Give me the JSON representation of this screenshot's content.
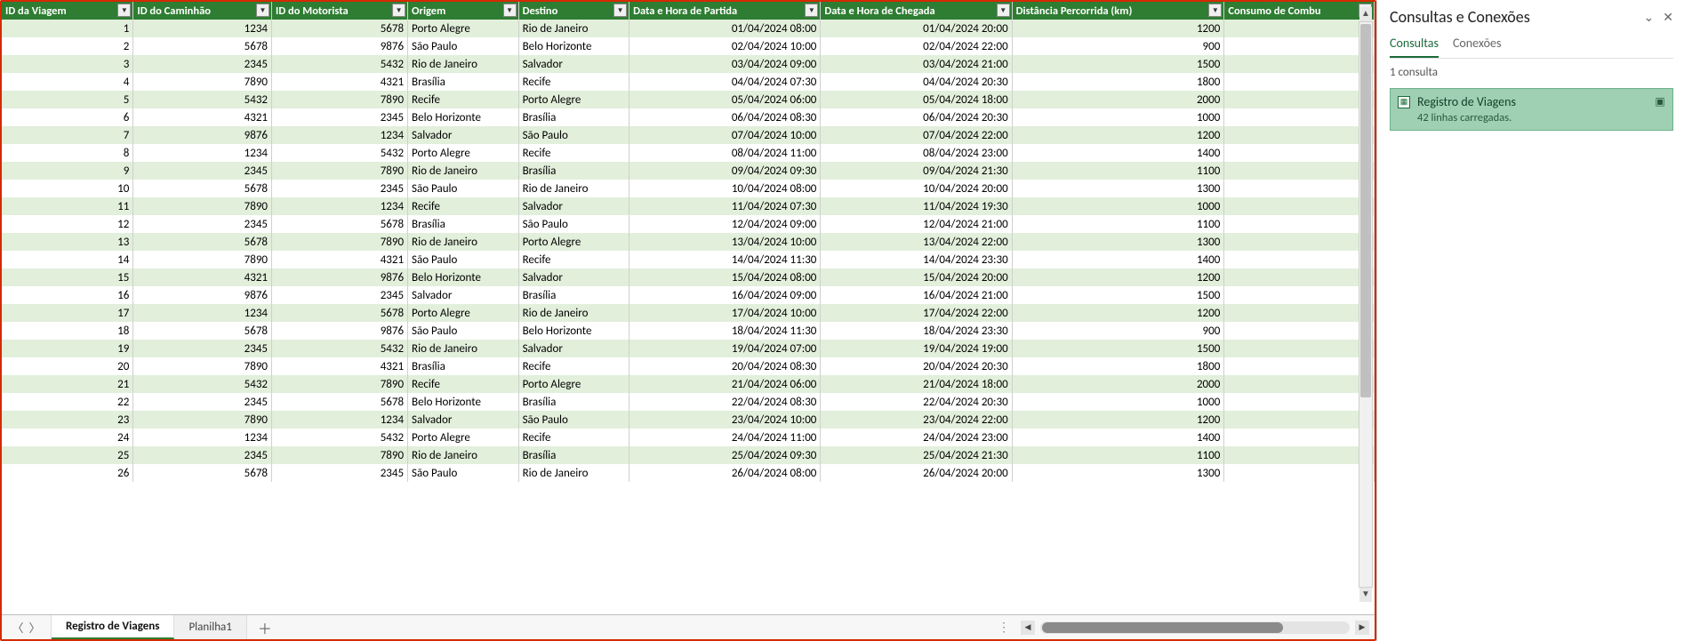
{
  "columns": [
    {
      "key": "id",
      "label": "ID da Viagem",
      "align": "num"
    },
    {
      "key": "truck",
      "label": "ID do Caminhão",
      "align": "num"
    },
    {
      "key": "driver",
      "label": "ID do Motorista",
      "align": "num"
    },
    {
      "key": "orig",
      "label": "Origem",
      "align": "txt"
    },
    {
      "key": "dest",
      "label": "Destino",
      "align": "txt"
    },
    {
      "key": "dep",
      "label": "Data e Hora de Partida",
      "align": "num"
    },
    {
      "key": "arr",
      "label": "Data e Hora de Chegada",
      "align": "num"
    },
    {
      "key": "dist",
      "label": "Distância Percorrida (km)",
      "align": "num"
    },
    {
      "key": "fuel",
      "label": "Consumo de Combu",
      "align": "txt"
    }
  ],
  "rows": [
    {
      "id": "1",
      "truck": "1234",
      "driver": "5678",
      "orig": "Porto Alegre",
      "dest": "Rio de Janeiro",
      "dep": "01/04/2024 08:00",
      "arr": "01/04/2024 20:00",
      "dist": "1200",
      "fuel": ""
    },
    {
      "id": "2",
      "truck": "5678",
      "driver": "9876",
      "orig": "São Paulo",
      "dest": "Belo Horizonte",
      "dep": "02/04/2024 10:00",
      "arr": "02/04/2024 22:00",
      "dist": "900",
      "fuel": ""
    },
    {
      "id": "3",
      "truck": "2345",
      "driver": "5432",
      "orig": "Rio de Janeiro",
      "dest": "Salvador",
      "dep": "03/04/2024 09:00",
      "arr": "03/04/2024 21:00",
      "dist": "1500",
      "fuel": ""
    },
    {
      "id": "4",
      "truck": "7890",
      "driver": "4321",
      "orig": "Brasília",
      "dest": "Recife",
      "dep": "04/04/2024 07:30",
      "arr": "04/04/2024 20:30",
      "dist": "1800",
      "fuel": ""
    },
    {
      "id": "5",
      "truck": "5432",
      "driver": "7890",
      "orig": "Recife",
      "dest": "Porto Alegre",
      "dep": "05/04/2024 06:00",
      "arr": "05/04/2024 18:00",
      "dist": "2000",
      "fuel": ""
    },
    {
      "id": "6",
      "truck": "4321",
      "driver": "2345",
      "orig": "Belo Horizonte",
      "dest": "Brasília",
      "dep": "06/04/2024 08:30",
      "arr": "06/04/2024 20:30",
      "dist": "1000",
      "fuel": ""
    },
    {
      "id": "7",
      "truck": "9876",
      "driver": "1234",
      "orig": "Salvador",
      "dest": "São Paulo",
      "dep": "07/04/2024 10:00",
      "arr": "07/04/2024 22:00",
      "dist": "1200",
      "fuel": ""
    },
    {
      "id": "8",
      "truck": "1234",
      "driver": "5432",
      "orig": "Porto Alegre",
      "dest": "Recife",
      "dep": "08/04/2024 11:00",
      "arr": "08/04/2024 23:00",
      "dist": "1400",
      "fuel": ""
    },
    {
      "id": "9",
      "truck": "2345",
      "driver": "7890",
      "orig": "Rio de Janeiro",
      "dest": "Brasília",
      "dep": "09/04/2024 09:30",
      "arr": "09/04/2024 21:30",
      "dist": "1100",
      "fuel": ""
    },
    {
      "id": "10",
      "truck": "5678",
      "driver": "2345",
      "orig": "São Paulo",
      "dest": "Rio de Janeiro",
      "dep": "10/04/2024 08:00",
      "arr": "10/04/2024 20:00",
      "dist": "1300",
      "fuel": ""
    },
    {
      "id": "11",
      "truck": "7890",
      "driver": "1234",
      "orig": "Recife",
      "dest": "Salvador",
      "dep": "11/04/2024 07:30",
      "arr": "11/04/2024 19:30",
      "dist": "1000",
      "fuel": ""
    },
    {
      "id": "12",
      "truck": "2345",
      "driver": "5678",
      "orig": "Brasília",
      "dest": "São Paulo",
      "dep": "12/04/2024 09:00",
      "arr": "12/04/2024 21:00",
      "dist": "1100",
      "fuel": ""
    },
    {
      "id": "13",
      "truck": "5678",
      "driver": "7890",
      "orig": "Rio de Janeiro",
      "dest": "Porto Alegre",
      "dep": "13/04/2024 10:00",
      "arr": "13/04/2024 22:00",
      "dist": "1300",
      "fuel": ""
    },
    {
      "id": "14",
      "truck": "7890",
      "driver": "4321",
      "orig": "São Paulo",
      "dest": "Recife",
      "dep": "14/04/2024 11:30",
      "arr": "14/04/2024 23:30",
      "dist": "1400",
      "fuel": ""
    },
    {
      "id": "15",
      "truck": "4321",
      "driver": "9876",
      "orig": "Belo Horizonte",
      "dest": "Salvador",
      "dep": "15/04/2024 08:00",
      "arr": "15/04/2024 20:00",
      "dist": "1200",
      "fuel": ""
    },
    {
      "id": "16",
      "truck": "9876",
      "driver": "2345",
      "orig": "Salvador",
      "dest": "Brasília",
      "dep": "16/04/2024 09:00",
      "arr": "16/04/2024 21:00",
      "dist": "1500",
      "fuel": ""
    },
    {
      "id": "17",
      "truck": "1234",
      "driver": "5678",
      "orig": "Porto Alegre",
      "dest": "Rio de Janeiro",
      "dep": "17/04/2024 10:00",
      "arr": "17/04/2024 22:00",
      "dist": "1200",
      "fuel": ""
    },
    {
      "id": "18",
      "truck": "5678",
      "driver": "9876",
      "orig": "São Paulo",
      "dest": "Belo Horizonte",
      "dep": "18/04/2024 11:30",
      "arr": "18/04/2024 23:30",
      "dist": "900",
      "fuel": ""
    },
    {
      "id": "19",
      "truck": "2345",
      "driver": "5432",
      "orig": "Rio de Janeiro",
      "dest": "Salvador",
      "dep": "19/04/2024 07:00",
      "arr": "19/04/2024 19:00",
      "dist": "1500",
      "fuel": ""
    },
    {
      "id": "20",
      "truck": "7890",
      "driver": "4321",
      "orig": "Brasília",
      "dest": "Recife",
      "dep": "20/04/2024 08:30",
      "arr": "20/04/2024 20:30",
      "dist": "1800",
      "fuel": ""
    },
    {
      "id": "21",
      "truck": "5432",
      "driver": "7890",
      "orig": "Recife",
      "dest": "Porto Alegre",
      "dep": "21/04/2024 06:00",
      "arr": "21/04/2024 18:00",
      "dist": "2000",
      "fuel": ""
    },
    {
      "id": "22",
      "truck": "2345",
      "driver": "5678",
      "orig": "Belo Horizonte",
      "dest": "Brasília",
      "dep": "22/04/2024 08:30",
      "arr": "22/04/2024 20:30",
      "dist": "1000",
      "fuel": ""
    },
    {
      "id": "23",
      "truck": "7890",
      "driver": "1234",
      "orig": "Salvador",
      "dest": "São Paulo",
      "dep": "23/04/2024 10:00",
      "arr": "23/04/2024 22:00",
      "dist": "1200",
      "fuel": ""
    },
    {
      "id": "24",
      "truck": "1234",
      "driver": "5432",
      "orig": "Porto Alegre",
      "dest": "Recife",
      "dep": "24/04/2024 11:00",
      "arr": "24/04/2024 23:00",
      "dist": "1400",
      "fuel": ""
    },
    {
      "id": "25",
      "truck": "2345",
      "driver": "7890",
      "orig": "Rio de Janeiro",
      "dest": "Brasília",
      "dep": "25/04/2024 09:30",
      "arr": "25/04/2024 21:30",
      "dist": "1100",
      "fuel": ""
    },
    {
      "id": "26",
      "truck": "5678",
      "driver": "2345",
      "orig": "São Paulo",
      "dest": "Rio de Janeiro",
      "dep": "26/04/2024 08:00",
      "arr": "26/04/2024 20:00",
      "dist": "1300",
      "fuel": ""
    }
  ],
  "sheet_tabs": {
    "active": "Registro de Viagens",
    "others": [
      "Planilha1"
    ]
  },
  "side_panel": {
    "title": "Consultas e Conexões",
    "tabs": {
      "queries": "Consultas",
      "connections": "Conexões"
    },
    "count_label": "1 consulta",
    "query": {
      "name": "Registro de Viagens",
      "status": "42 linhas carregadas."
    }
  },
  "chart_data": {
    "type": "table",
    "title": "Registro de Viagens",
    "columns": [
      "ID da Viagem",
      "ID do Caminhão",
      "ID do Motorista",
      "Origem",
      "Destino",
      "Data e Hora de Partida",
      "Data e Hora de Chegada",
      "Distância Percorrida (km)"
    ],
    "note": "Spreadsheet table — see rows[] for data"
  }
}
